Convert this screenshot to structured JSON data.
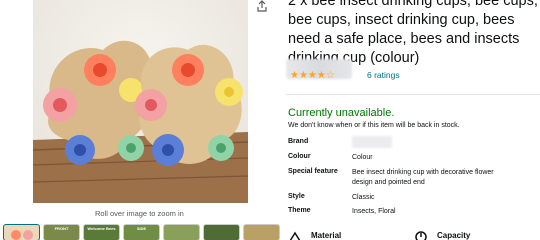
{
  "product": {
    "title": "2 x bee insect drinking cups, bee cups, bee cups, insect drinking cup, bees need a safe place, bees and insects drinking cup (colour)",
    "ratings_text": "6 ratings",
    "stars_glyph": "★★★★☆",
    "availability": "Currently unavailable.",
    "availability_note": "We don't know when or if this item will be back in stock.",
    "zoom_hint": "Roll over image to zoom in"
  },
  "specs": [
    {
      "key": "Brand",
      "value": ""
    },
    {
      "key": "Colour",
      "value": "Colour"
    },
    {
      "key": "Special feature",
      "value": "Bee insect drinking cup with decorative flower design and pointed end"
    },
    {
      "key": "Style",
      "value": "Classic"
    },
    {
      "key": "Theme",
      "value": "Insects, Floral"
    }
  ],
  "thumbnails": [
    {
      "label": ""
    },
    {
      "label": "FRONT"
    },
    {
      "label": "Welcome Bees"
    },
    {
      "label": "SIDE"
    },
    {
      "label": ""
    },
    {
      "label": ""
    },
    {
      "label": ""
    }
  ],
  "features": [
    {
      "label": "Material",
      "icon": "material-icon"
    },
    {
      "label": "Capacity",
      "icon": "capacity-icon"
    }
  ],
  "colors": {
    "link": "#007185",
    "available_green": "#007600",
    "star": "#ffa41c"
  }
}
